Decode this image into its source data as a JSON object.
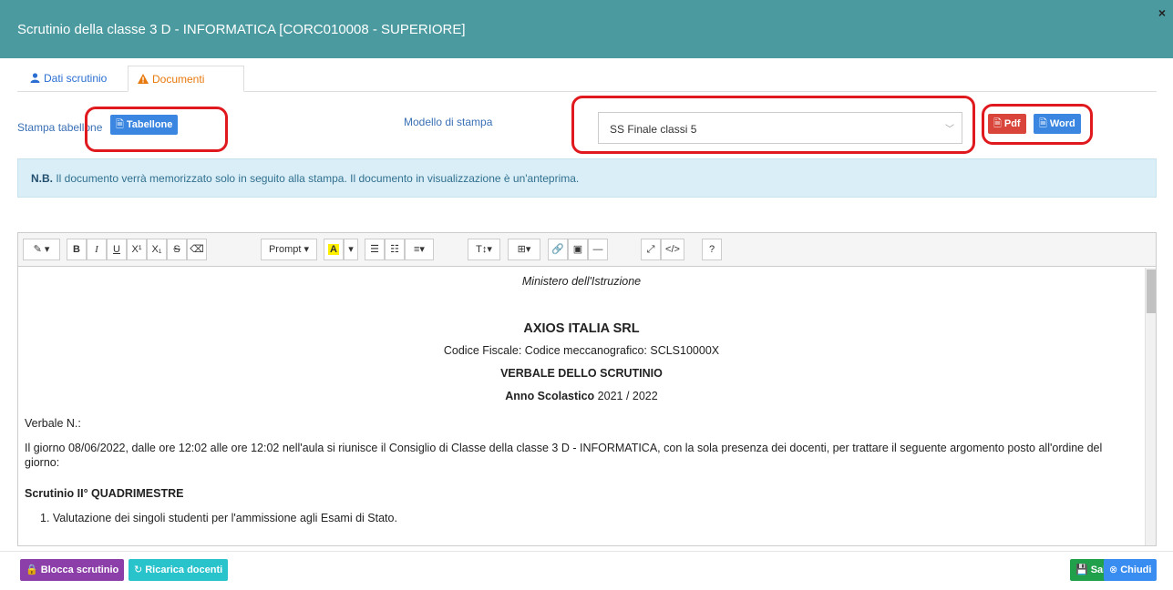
{
  "header": {
    "title": "Scrutinio della classe 3 D - INFORMATICA [CORC010008 - SUPERIORE]",
    "close": "×"
  },
  "tabs": [
    {
      "label": "Dati scrutinio",
      "icon": "user-icon"
    },
    {
      "label": "Documenti",
      "icon": "warning-icon"
    }
  ],
  "print": {
    "table_label": "Stampa tabellone",
    "table_button": "Tabellone",
    "model_label": "Modello di stampa",
    "model_selected": "SS Finale classi 5",
    "pdf_button": "Pdf",
    "word_button": "Word"
  },
  "note": {
    "bold": "N.B.",
    "text": " Il documento verrà memorizzato solo in seguito alla stampa. Il documento in visualizzazione è un'anteprima."
  },
  "toolbar": {
    "prompt": "Prompt"
  },
  "document": {
    "ministry": "Ministero dell'Istruzione",
    "company": "AXIOS ITALIA SRL",
    "codes": "Codice Fiscale: Codice meccanografico: SCLS10000X",
    "verbale_title": "VERBALE DELLO SCRUTINIO",
    "year_label": "Anno Scolastico",
    "year_value": " 2021 / 2022",
    "verbale_n": "Verbale N.:",
    "paragraph": "Il giorno 08/06/2022, dalle ore 12:02 alle ore 12:02 nell'aula si riunisce il Consiglio di Classe della classe 3 D - INFORMATICA, con la sola presenza dei docenti, per trattare il seguente argomento posto all'ordine del giorno:",
    "section": "Scrutinio II° QUADRIMESTRE",
    "item1": "1. Valutazione dei singoli studenti per l'ammissione agli Esami di Stato."
  },
  "footer": {
    "lock": "Blocca scrutinio",
    "reload": "Ricarica docenti",
    "save": "Salva",
    "close": "Chiudi"
  },
  "colors": {
    "header": "#4a9aa0",
    "primary": "#3a86e0",
    "danger": "#d9453a",
    "highlight_box": "#e0191f"
  }
}
